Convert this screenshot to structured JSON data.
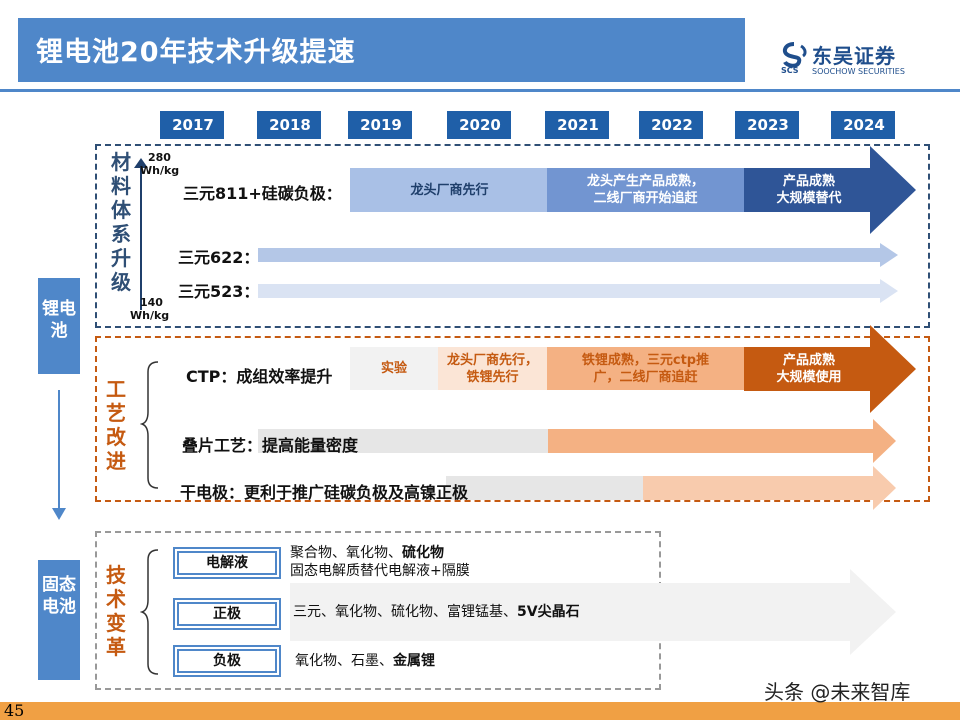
{
  "header": {
    "title": "锂电池20年技术升级提速",
    "logo_cn": "东吴证券",
    "logo_en": "SOOCHOW SECURITIES",
    "logo_mark": "SCS"
  },
  "years": [
    "2017",
    "2018",
    "2019",
    "2020",
    "2021",
    "2022",
    "2023",
    "2024"
  ],
  "side_labels": {
    "top": "锂电池",
    "bottom": "固态电池"
  },
  "materials": {
    "label": "材料体系升级",
    "unit_top": "280 Wh/kg",
    "unit_top_a": "280",
    "unit_top_b": "Wh/kg",
    "unit_bottom_a": "140",
    "unit_bottom_b": "Wh/kg",
    "rows": [
      {
        "label": "三元811+硅碳负极：",
        "stages": [
          "龙头厂商先行",
          "龙头产生产品成熟，二线厂商开始追赶",
          "产品成熟大规模替代"
        ]
      },
      {
        "label": "三元622："
      },
      {
        "label": "三元523："
      }
    ],
    "stage2_line1": "龙头产生产品成熟，",
    "stage2_line2": "二线厂商开始追赶",
    "stage3_line1": "产品成熟",
    "stage3_line2": "大规模替代"
  },
  "process": {
    "label": "工艺改进",
    "rows": [
      {
        "label": "CTP：成组效率提升"
      },
      {
        "label": "叠片工艺：提高能量密度"
      },
      {
        "label": "干电极：更利于推广硅碳负极及高镍正极"
      }
    ],
    "stage1": "实验",
    "stage2_line1": "龙头厂商先行，",
    "stage2_line2": "铁锂先行",
    "stage3_line1": "铁锂成熟，三元ctp推",
    "stage3_line2": "广，二线厂商追赶",
    "stage4_line1": "产品成熟",
    "stage4_line2": "大规模使用"
  },
  "tech": {
    "label": "技术变革",
    "electrolyte": {
      "name": "电解液",
      "line1_plain": "聚合物、氧化物、",
      "line1_bold": "硫化物",
      "line2": "固态电解质替代电解液+隔膜"
    },
    "cathode": {
      "name": "正极",
      "plain": "三元、氧化物、硫化物、富锂锰基、",
      "bold": "5V尖晶石"
    },
    "anode": {
      "name": "负极",
      "plain": "氧化物、石墨、",
      "bold": "金属锂"
    }
  },
  "footer": {
    "page": "45",
    "watermark": "头条 @未来智库"
  },
  "colors": {
    "brand_blue": "#4f87c9",
    "dark_blue": "#1f5fa8",
    "orange_dark": "#c55a11",
    "orange_light": "#f4b183",
    "gray_light": "#e6e6e6"
  }
}
